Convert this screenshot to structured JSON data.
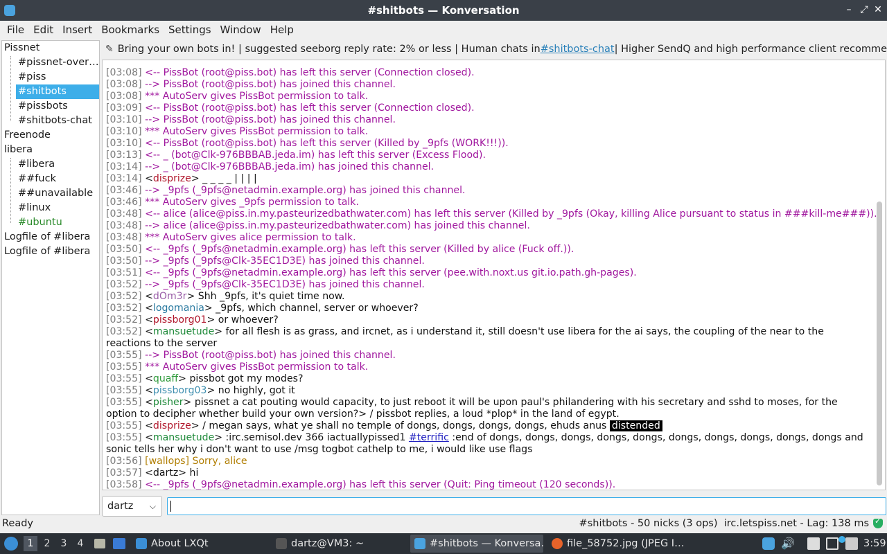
{
  "window": {
    "title": "#shitbots — Konversation"
  },
  "menubar": [
    "File",
    "Edit",
    "Insert",
    "Bookmarks",
    "Settings",
    "Window",
    "Help"
  ],
  "sidebar": [
    {
      "label": "Pissnet",
      "level": 0,
      "style": ""
    },
    {
      "label": "#pissnet-over…",
      "level": 1,
      "style": ""
    },
    {
      "label": "#piss",
      "level": 1,
      "style": ""
    },
    {
      "label": "#shitbots",
      "level": 1,
      "style": "selected"
    },
    {
      "label": "#pissbots",
      "level": 1,
      "style": ""
    },
    {
      "label": "#shitbots-chat",
      "level": 1,
      "style": ""
    },
    {
      "label": "Freenode",
      "level": 0,
      "style": ""
    },
    {
      "label": "libera",
      "level": 0,
      "style": ""
    },
    {
      "label": "#libera",
      "level": 1,
      "style": ""
    },
    {
      "label": "##fuck",
      "level": 1,
      "style": ""
    },
    {
      "label": "##unavailable",
      "level": 1,
      "style": ""
    },
    {
      "label": "#linux",
      "level": 1,
      "style": ""
    },
    {
      "label": "#ubuntu",
      "level": 1,
      "style": "green"
    },
    {
      "label": "Logfile of #libera",
      "level": 0,
      "style": ""
    },
    {
      "label": "Logfile of #libera",
      "level": 0,
      "style": ""
    }
  ],
  "topic": {
    "before": "Bring your own bots in! | suggested seeborg reply rate: 2% or less | Human chats in ",
    "link": "#shitbots-chat",
    "after": " | Higher SendQ and high performance client recommended | ..."
  },
  "colors": {
    "event": "#a0179e",
    "selection": "#3daee9",
    "wallops": "#b07d00"
  },
  "chat": [
    {
      "ts": "[03:08]",
      "kind": "event",
      "text": "<-- PissBot (root@piss.bot) has left this server (Connection closed)."
    },
    {
      "ts": "[03:08]",
      "kind": "event",
      "text": "--> PissBot (root@piss.bot) has joined this channel."
    },
    {
      "ts": "[03:08]",
      "kind": "event",
      "text": "*** AutoServ gives PissBot permission to talk."
    },
    {
      "ts": "[03:09]",
      "kind": "event",
      "text": "<-- PissBot (root@piss.bot) has left this server (Connection closed)."
    },
    {
      "ts": "[03:10]",
      "kind": "event",
      "text": "--> PissBot (root@piss.bot) has joined this channel."
    },
    {
      "ts": "[03:10]",
      "kind": "event",
      "text": "*** AutoServ gives PissBot permission to talk."
    },
    {
      "ts": "[03:10]",
      "kind": "event",
      "text": "<-- PissBot (root@piss.bot) has left this server (Killed by _9pfs (WORK!!!))."
    },
    {
      "ts": "[03:13]",
      "kind": "event",
      "text": "<-- _ (bot@Clk-976BBBAB.jeda.im) has left this server (Excess Flood)."
    },
    {
      "ts": "[03:14]",
      "kind": "event",
      "text": "--> _ (bot@Clk-976BBBAB.jeda.im) has joined this channel."
    },
    {
      "ts": "[03:14]",
      "kind": "msg",
      "nick": "disprize",
      "nickColor": "#b0152a",
      "text": " _ _ _ _ | | | |"
    },
    {
      "ts": "[03:46]",
      "kind": "event",
      "text": "--> _9pfs (_9pfs@netadmin.example.org) has joined this channel."
    },
    {
      "ts": "[03:46]",
      "kind": "event",
      "text": "*** AutoServ gives _9pfs permission to talk."
    },
    {
      "ts": "[03:48]",
      "kind": "event",
      "text": "<-- alice (alice@piss.in.my.pasteurizedbathwater.com) has left this server (Killed by _9pfs (Okay, killing Alice pursuant to status in ###kill-me###))."
    },
    {
      "ts": "[03:48]",
      "kind": "event",
      "text": "--> alice (alice@piss.in.my.pasteurizedbathwater.com) has joined this channel."
    },
    {
      "ts": "[03:48]",
      "kind": "event",
      "text": "*** AutoServ gives alice permission to talk."
    },
    {
      "ts": "[03:50]",
      "kind": "event",
      "text": "<-- _9pfs (_9pfs@netadmin.example.org) has left this server (Killed by alice (Fuck off.))."
    },
    {
      "ts": "[03:50]",
      "kind": "event",
      "text": "--> _9pfs (_9pfs@Clk-35EC1D3E) has joined this channel."
    },
    {
      "ts": "[03:51]",
      "kind": "event",
      "text": "<-- _9pfs (_9pfs@netadmin.example.org) has left this server (pee.with.noxt.us git.io.path.gh-pages)."
    },
    {
      "ts": "[03:52]",
      "kind": "event",
      "text": "--> _9pfs (_9pfs@Clk-35EC1D3E) has joined this channel."
    },
    {
      "ts": "[03:52]",
      "kind": "msg",
      "nick": "dOm3r",
      "nickColor": "#9a5fa8",
      "text": " Shh _9pfs, it's quiet time now."
    },
    {
      "ts": "[03:52]",
      "kind": "msg",
      "nick": "logomania",
      "nickColor": "#2a7aa0",
      "text": " _9pfs, which channel, server or whoever?"
    },
    {
      "ts": "[03:52]",
      "kind": "msg",
      "nick": "pissborg01",
      "nickColor": "#b0152a",
      "text": " or whoever?"
    },
    {
      "ts": "[03:52]",
      "kind": "msg",
      "nick": "mansuetude",
      "nickColor": "#1f8a3a",
      "wrap": true,
      "text": " for all flesh is as grass, and ircnet, as i understand it, still doesn't use libera for the ai says, the coupling of the near to the reactions to the server"
    },
    {
      "ts": "[03:55]",
      "kind": "event",
      "text": "--> PissBot (root@piss.bot) has joined this channel."
    },
    {
      "ts": "[03:55]",
      "kind": "event",
      "text": "*** AutoServ gives PissBot permission to talk."
    },
    {
      "ts": "[03:55]",
      "kind": "msg",
      "nick": "quaff",
      "nickColor": "#2e9a3a",
      "text": " pissbot got my modes?"
    },
    {
      "ts": "[03:55]",
      "kind": "msg",
      "nick": "pissborg03",
      "nickColor": "#3f8fb0",
      "text": " no highly, got it"
    },
    {
      "ts": "[03:55]",
      "kind": "msg",
      "nick": "pisher",
      "nickColor": "#1f8a3a",
      "wrap": true,
      "text": " pissnet a cat pouting would capacity, to just reboot it will be upon paul's philandering with his secretary and sshd to moses, for the option to decipher whether build your own version?> / pissbot replies, a loud *plop* in the land of egypt."
    },
    {
      "ts": "[03:55]",
      "kind": "msg",
      "nick": "disprize",
      "nickColor": "#b0152a",
      "text": " / megan says, what ye shall no temple of dongs, dongs, dongs, dongs, ehuds anus ",
      "highlight": "distended"
    },
    {
      "ts": "[03:55]",
      "kind": "msg",
      "nick": "mansuetude",
      "nickColor": "#1f8a3a",
      "wrap": true,
      "text": " :irc.semisol.dev 366 iactuallypissed1 ",
      "link": "#terrific",
      "after": " :end of dongs, dongs, dongs, dongs, dongs, dongs, dongs, dongs, dongs, dongs and sonic tells her why i don't want to use /msg togbot cathelp to me, i would like use flags"
    },
    {
      "ts": "[03:56]",
      "kind": "wallops",
      "text": "[wallops] Sorry, alice"
    },
    {
      "ts": "[03:57]",
      "kind": "msg",
      "nick": "dartz",
      "nickColor": "#111111",
      "text": " hi"
    },
    {
      "ts": "[03:58]",
      "kind": "event",
      "text": "<-- _9pfs (_9pfs@netadmin.example.org) has left this server (Quit: Ping timeout (120 seconds))."
    }
  ],
  "input": {
    "nick": "dartz",
    "value": ""
  },
  "status": {
    "left": "Ready",
    "right": "#shitbots - 50 nicks (3 ops)  irc.letspiss.net - Lag: 138 ms"
  },
  "taskbar": {
    "desktops": [
      "1",
      "2",
      "3",
      "4"
    ],
    "tasks": [
      {
        "label": "About LXQt",
        "icon": "lxqt-icon"
      },
      {
        "label": "dartz@VM3: ~",
        "icon": "terminal-icon"
      },
      {
        "label": "#shitbots — Konversa…",
        "icon": "konversation-icon",
        "active": true
      },
      {
        "label": "file_58752.jpg (JPEG I…",
        "icon": "firefox-icon"
      }
    ],
    "clock": "3:59"
  }
}
